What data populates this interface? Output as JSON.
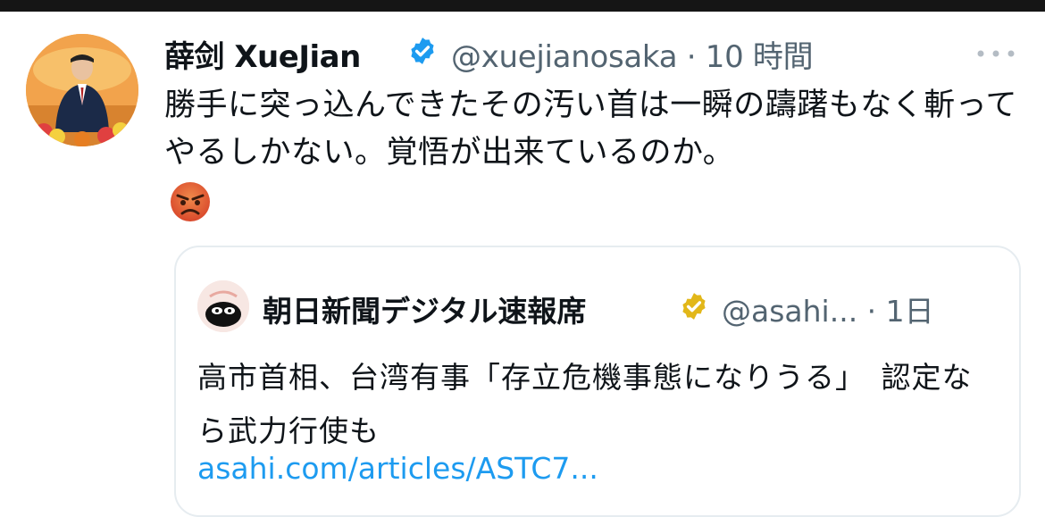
{
  "tweet": {
    "display_name": "薛剑 XueJian",
    "handle_and_time": "@xuejianosaka · 10 時間",
    "text": "勝手に突っ込んできたその汚い首は一瞬の躊躇もなく斬ってやるしかない。覚悟が出来ているのか。",
    "emoji": "angry-face",
    "icons": {
      "verified": "verified-badge-blue",
      "more": "more-dots-icon"
    },
    "colors": {
      "verified": "#1d9bf0",
      "handle": "#536471",
      "text": "#0f1419"
    }
  },
  "quoted_tweet": {
    "display_name": "朝日新聞デジタル速報席",
    "handle_and_time": "@asahi... · 1日",
    "text": "高市首相、台湾有事「存立危機事態になりうる」　認定なら武力行使も",
    "link": "asahi.com/articles/ASTC7...",
    "icons": {
      "verified": "verified-badge-gold"
    },
    "colors": {
      "verified": "#e2b719",
      "link": "#1d9bf0"
    }
  }
}
